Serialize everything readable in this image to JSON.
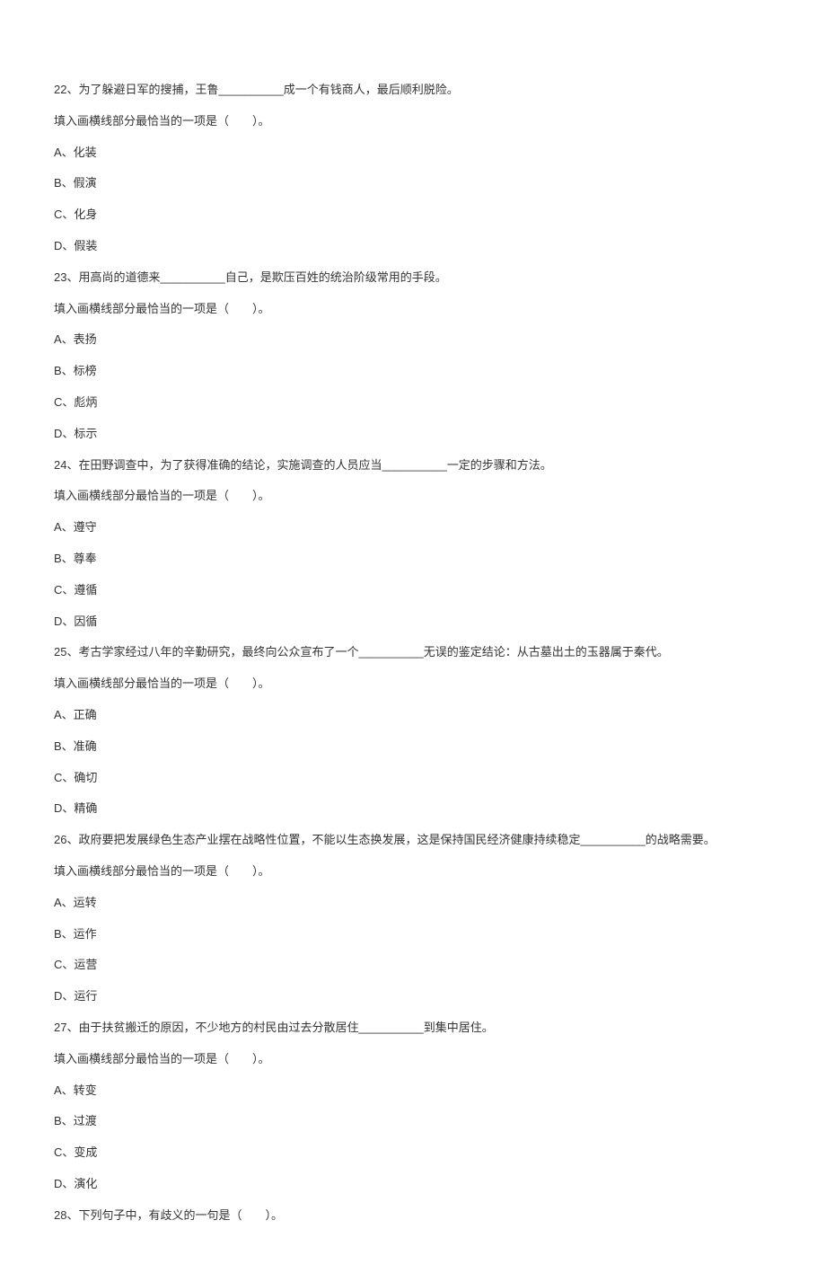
{
  "questions": [
    {
      "num": "22",
      "text": "、为了躲避日军的搜捕，王鲁__________成一个有钱商人，最后顺利脱险。",
      "prompt": "填入画横线部分最恰当的一项是（　　）。",
      "options": [
        "A、化装",
        "B、假演",
        "C、化身",
        "D、假装"
      ]
    },
    {
      "num": "23",
      "text": "、用高尚的道德来__________自己，是欺压百姓的统治阶级常用的手段。",
      "prompt": "填入画横线部分最恰当的一项是（　　）。",
      "options": [
        "A、表扬",
        "B、标榜",
        "C、彪炳",
        "D、标示"
      ]
    },
    {
      "num": "24",
      "text": "、在田野调查中，为了获得准确的结论，实施调查的人员应当__________一定的步骤和方法。",
      "prompt": "填入画横线部分最恰当的一项是（　　）。",
      "options": [
        "A、遵守",
        "B、尊奉",
        "C、遵循",
        "D、因循"
      ]
    },
    {
      "num": "25",
      "text": "、考古学家经过八年的辛勤研究，最终向公众宣布了一个__________无误的鉴定结论：从古墓出土的玉器属于秦代。",
      "prompt": "填入画横线部分最恰当的一项是（　　）。",
      "options": [
        "A、正确",
        "B、准确",
        "C、确切",
        "D、精确"
      ]
    },
    {
      "num": "26",
      "text": "、政府要把发展绿色生态产业摆在战略性位置，不能以生态换发展，这是保持国民经济健康持续稳定__________的战略需要。",
      "prompt": "填入画横线部分最恰当的一项是（　　）。",
      "options": [
        "A、运转",
        "B、运作",
        "C、运营",
        "D、运行"
      ]
    },
    {
      "num": "27",
      "text": "、由于扶贫搬迁的原因，不少地方的村民由过去分散居住__________到集中居住。",
      "prompt": "填入画横线部分最恰当的一项是（　　）。",
      "options": [
        "A、转变",
        "B、过渡",
        "C、变成",
        "D、演化"
      ]
    },
    {
      "num": "28",
      "text": "、下列句子中，有歧义的一句是（　　）。",
      "prompt": "",
      "options": []
    }
  ]
}
